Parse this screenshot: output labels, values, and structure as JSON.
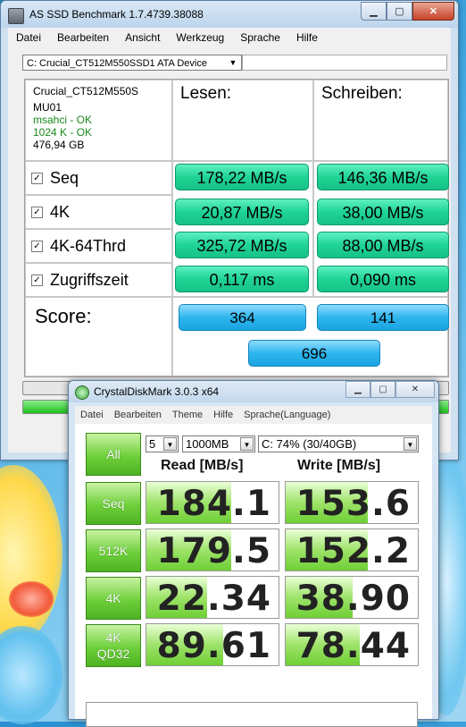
{
  "asssd": {
    "title": "AS SSD Benchmark 1.7.4739.38088",
    "menu": [
      "Datei",
      "Bearbeiten",
      "Ansicht",
      "Werkzeug",
      "Sprache",
      "Hilfe"
    ],
    "drive": "C: Crucial_CT512M550SSD1 ATA Device",
    "info": {
      "model": "Crucial_CT512M550S",
      "firmware": "MU01",
      "driver": "msahci - OK",
      "alignment": "1024 K - OK",
      "size": "476,94 GB"
    },
    "headers": {
      "read": "Lesen:",
      "write": "Schreiben:"
    },
    "rows": [
      {
        "label": "Seq",
        "read": "178,22 MB/s",
        "write": "146,36 MB/s"
      },
      {
        "label": "4K",
        "read": "20,87 MB/s",
        "write": "38,00 MB/s"
      },
      {
        "label": "4K-64Thrd",
        "read": "325,72 MB/s",
        "write": "88,00 MB/s"
      },
      {
        "label": "Zugriffszeit",
        "read": "0,117 ms",
        "write": "0,090 ms"
      }
    ],
    "score": {
      "label": "Score:",
      "read": "364",
      "write": "141",
      "total": "696"
    },
    "progress_fraction": 1.0,
    "checkmark": "✓",
    "colors": {
      "result_green": "#1fd495",
      "score_blue": "#2db6ee"
    }
  },
  "cdm": {
    "title": "CrystalDiskMark 3.0.3 x64",
    "menu": [
      "Datei",
      "Bearbeiten",
      "Theme",
      "Hilfe",
      "Sprache(Language)"
    ],
    "all_label": "All",
    "count": "5",
    "size": "1000MB",
    "drive": "C: 74% (30/40GB)",
    "read_header": "Read [MB/s]",
    "write_header": "Write [MB/s]",
    "rows": [
      {
        "label": "Seq",
        "label2": "",
        "read": "184.1",
        "write": "153.6",
        "read_frac": 0.64,
        "write_frac": 0.62
      },
      {
        "label": "512K",
        "label2": "",
        "read": "179.5",
        "write": "152.2",
        "read_frac": 0.64,
        "write_frac": 0.62
      },
      {
        "label": "4K",
        "label2": "",
        "read": "22.34",
        "write": "38.90",
        "read_frac": 0.46,
        "write_frac": 0.51
      },
      {
        "label": "4K",
        "label2": "QD32",
        "read": "89.61",
        "write": "78.44",
        "read_frac": 0.58,
        "write_frac": 0.56
      }
    ]
  }
}
